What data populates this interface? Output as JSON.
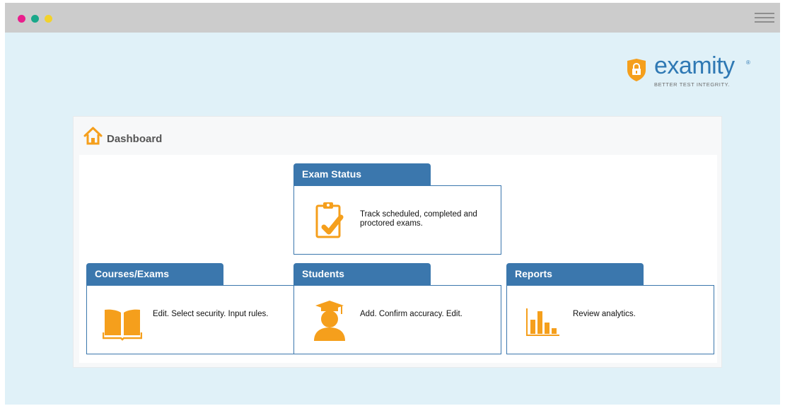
{
  "window": {
    "controls": [
      {
        "name": "close",
        "color": "#e91e8c"
      },
      {
        "name": "minimize",
        "color": "#1aa88a"
      },
      {
        "name": "maximize",
        "color": "#f2d22c"
      }
    ]
  },
  "brand": {
    "name": "examity",
    "tagline": "BETTER TEST INTEGRITY.",
    "accent": "#f59f1c",
    "blue": "#2f79b4"
  },
  "dashboard": {
    "title": "Dashboard",
    "cards": {
      "exam_status": {
        "title": "Exam Status",
        "description": "Track scheduled, completed and proctored exams.",
        "icon": "clipboard-check-icon"
      },
      "courses_exams": {
        "title": "Courses/Exams",
        "description": "Edit. Select security. Input rules.",
        "icon": "open-book-icon"
      },
      "students": {
        "title": "Students",
        "description": "Add. Confirm accuracy. Edit.",
        "icon": "graduate-icon"
      },
      "reports": {
        "title": "Reports",
        "description": "Review analytics.",
        "icon": "bar-chart-icon"
      }
    }
  }
}
